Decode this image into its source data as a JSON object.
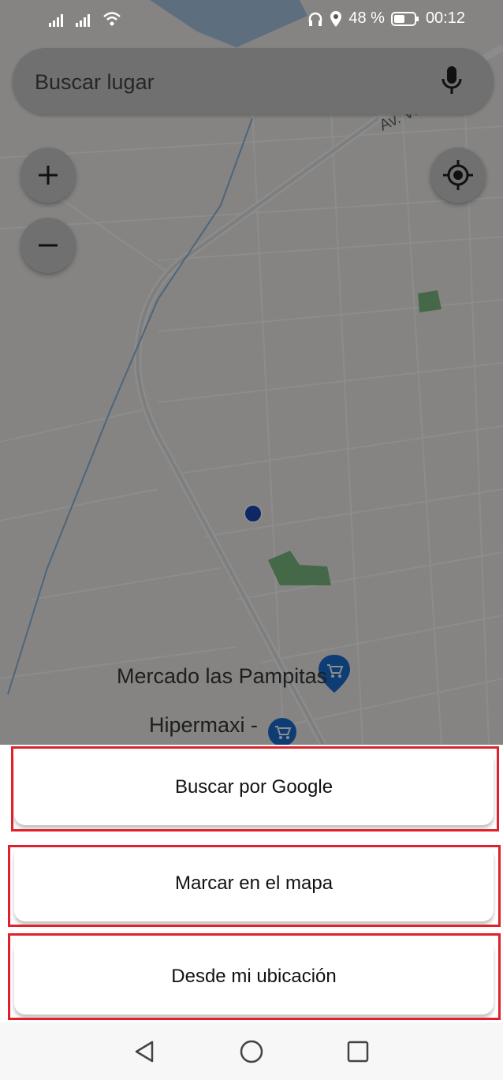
{
  "status_bar": {
    "battery_percent": "48 %",
    "time": "00:12"
  },
  "search": {
    "placeholder": "Buscar lugar"
  },
  "map": {
    "street_label": "Av. Vi",
    "poi_1": "Mercado las Pampitas",
    "poi_2": "Hipermaxi -"
  },
  "options": {
    "google": "Buscar por Google",
    "mark_on_map": "Marcar en el mapa",
    "my_location": "Desde mi ubicación"
  },
  "colors": {
    "highlight": "#e0202a",
    "location_dot": "#1a47b8",
    "park": "#5b9b5e",
    "poi_pin": "#1a6fd6"
  },
  "icons": {
    "mic": "mic-icon",
    "zoom_in": "plus-icon",
    "zoom_out": "minus-icon",
    "locate": "my-location-icon",
    "back": "triangle-back-icon",
    "home": "circle-home-icon",
    "recents": "square-recents-icon"
  }
}
